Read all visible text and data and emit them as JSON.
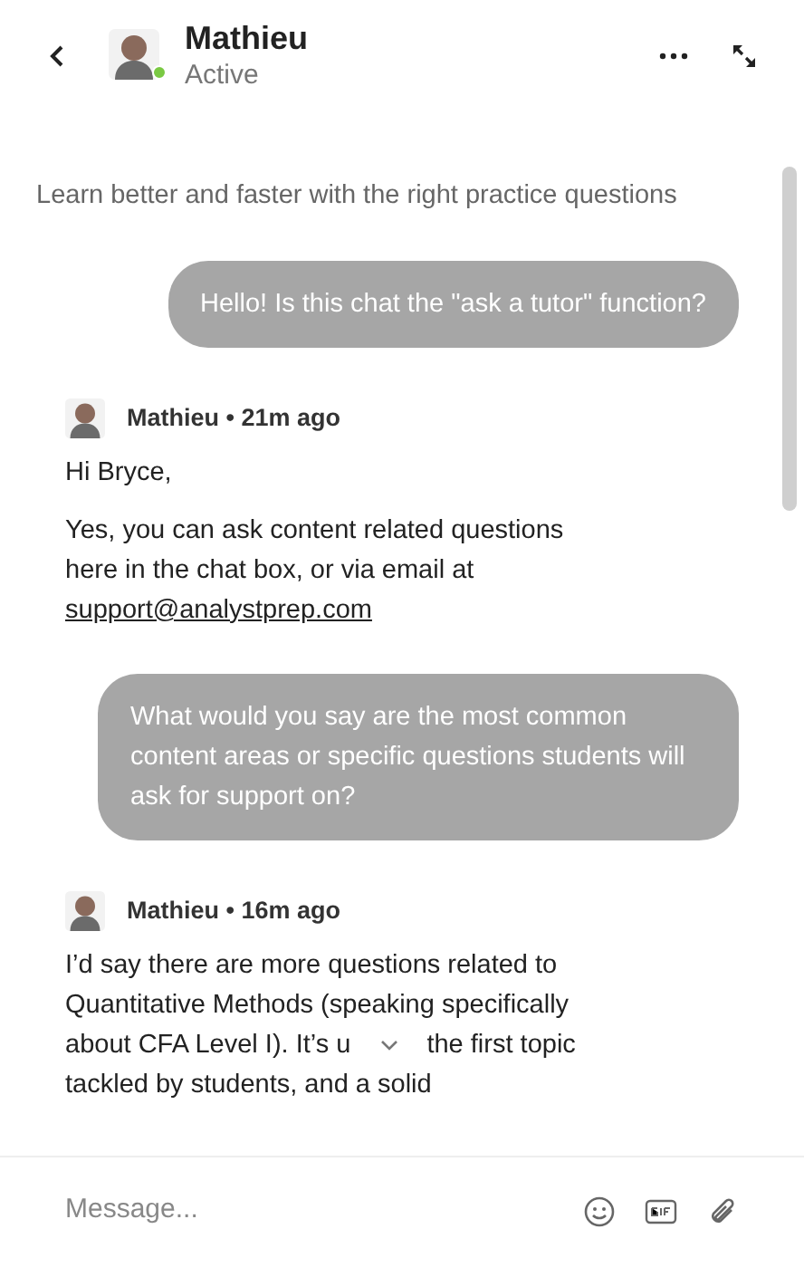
{
  "header": {
    "name": "Mathieu",
    "status": "Active",
    "online": true
  },
  "tagline": "Learn better and faster with the right practice questions",
  "messages": [
    {
      "kind": "sent",
      "text": "Hello! Is this chat the \"ask a tutor\" function?"
    },
    {
      "kind": "received",
      "author": "Mathieu • 21m ago",
      "paragraphs": [
        "Hi Bryce,",
        "Yes, you can ask content related questions here in the chat box, or via email at"
      ],
      "link": "support@analystprep.com"
    },
    {
      "kind": "sent",
      "text": "What would you say are the most common content areas or specific questions students will ask for support on?"
    },
    {
      "kind": "received_partial",
      "author": "Mathieu • 16m ago",
      "lines": [
        "I’d say there are more questions related to",
        "Quantitative Methods (speaking specifically"
      ],
      "split_line": [
        "about CFA Level I). It’s u",
        "the first topic"
      ],
      "last_line": "tackled by students, and a solid"
    }
  ],
  "composer": {
    "placeholder": "Message..."
  }
}
